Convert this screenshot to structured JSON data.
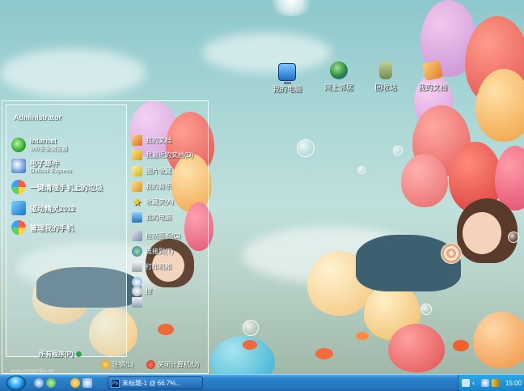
{
  "desktop_icons": [
    {
      "label": "我的电脑",
      "icon": "computer-icon"
    },
    {
      "label": "网上邻居",
      "icon": "network-icon"
    },
    {
      "label": "回收站",
      "icon": "recycle-bin-icon"
    },
    {
      "label": "我的文档",
      "icon": "documents-icon"
    }
  ],
  "start_menu": {
    "user": "Administrator",
    "pinned": [
      {
        "title": "Internet",
        "subtitle": "360安全浏览器"
      },
      {
        "title": "电子邮件",
        "subtitle": "Outlook Express"
      }
    ],
    "recent": [
      {
        "title": "一键清理手机上的垃圾"
      },
      {
        "title": "驱动精灵2012"
      },
      {
        "title": "管理我的手机"
      }
    ],
    "all_programs": "所有程序(P)",
    "places": [
      {
        "label": "我的文档"
      },
      {
        "label": "我最近的文档(D)"
      },
      {
        "label": "图片收藏"
      },
      {
        "label": "我的音乐"
      },
      {
        "label": "收藏夹(A)"
      },
      {
        "label": "我的电脑"
      },
      {
        "label": "控制面板(C)"
      },
      {
        "label": "连接到(T)"
      },
      {
        "label": "打印机和"
      },
      {
        "label": ""
      },
      {
        "label": "搜"
      },
      {
        "label": ""
      }
    ],
    "logoff": "注销(L)",
    "shutdown": "关闭计算机(U)",
    "watermark": "www.xitongzhijia.net"
  },
  "taskbar": {
    "task_label": "未标题-1 @ 66.7%...",
    "task_app_glyph": "Ps",
    "clock": "15:00"
  },
  "colors": {
    "taskbar": "#2a7cc4",
    "tray": "#1583cc"
  }
}
